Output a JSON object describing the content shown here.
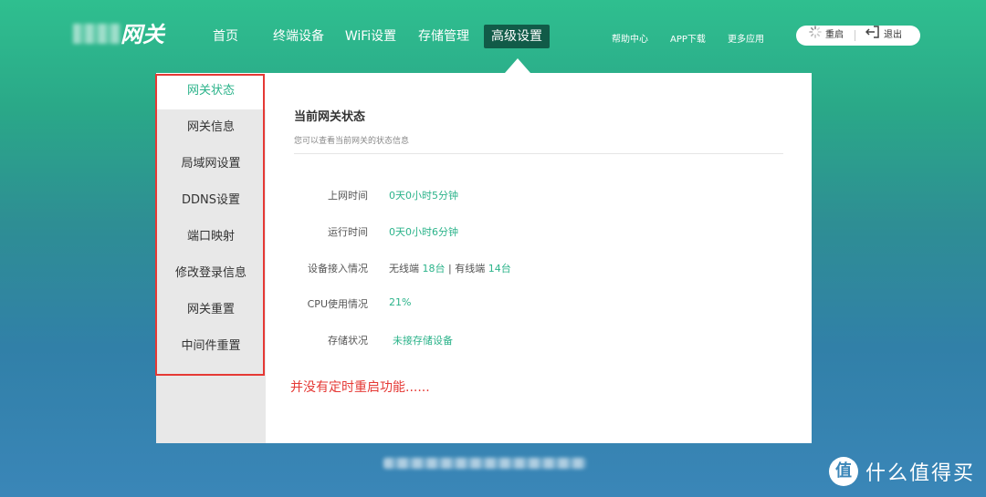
{
  "logo": {
    "text": "网关"
  },
  "nav": {
    "items": [
      "首页",
      "终端设备",
      "WiFi设置",
      "存储管理",
      "高级设置"
    ],
    "active_index": 4
  },
  "toplinks": [
    "帮助中心",
    "APP下载",
    "更多应用"
  ],
  "actions": {
    "restart_label": "重启",
    "logout_label": "退出"
  },
  "sidebar": {
    "items": [
      "网关状态",
      "网关信息",
      "局域网设置",
      "DDNS设置",
      "端口映射",
      "修改登录信息",
      "网关重置",
      "中间件重置"
    ],
    "active_index": 0
  },
  "main": {
    "title": "当前网关状态",
    "subtitle": "您可以查看当前网关的状态信息",
    "rows": [
      {
        "label": "上网时间",
        "value": "0天0小时5分钟"
      },
      {
        "label": "运行时间",
        "value": "0天0小时6分钟"
      },
      {
        "label": "设备接入情况",
        "wireless_label": "无线端",
        "wireless_value": "18台",
        "separator": "|",
        "wired_label": "有线端",
        "wired_value": "14台"
      },
      {
        "label": "CPU使用情况",
        "value": "21%"
      },
      {
        "label": "存储状况",
        "value": "未接存储设备"
      }
    ]
  },
  "annotation": "并没有定时重启功能......",
  "watermark": {
    "icon_text": "值",
    "text": "什么值得买"
  },
  "colors": {
    "accent": "#2bb38a",
    "nav_active": "#115b48",
    "highlight": "#e53935"
  }
}
